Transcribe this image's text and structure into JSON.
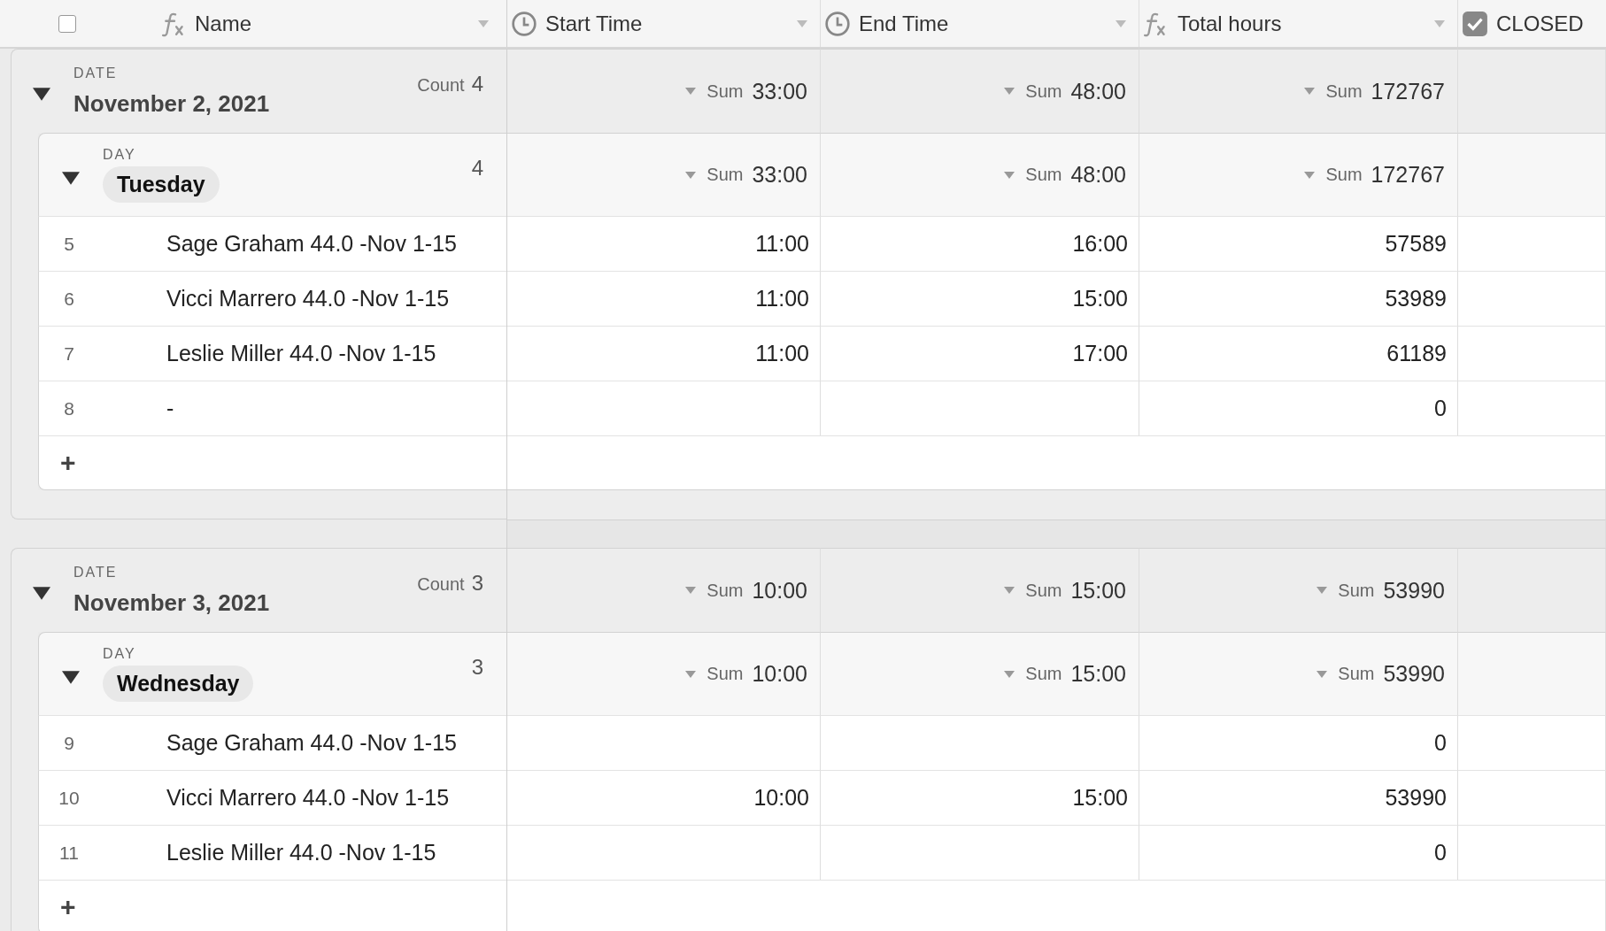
{
  "header": {
    "select_all": {
      "checked": false
    },
    "columns": [
      {
        "label": "Name"
      },
      {
        "label": "Start Time"
      },
      {
        "label": "End Time"
      },
      {
        "label": "Total hours"
      },
      {
        "label": "CLOSED"
      }
    ]
  },
  "groups": [
    {
      "field_label": "DATE",
      "title": "November 2, 2021",
      "count_label": "Count",
      "count": "4",
      "expanded": true,
      "sums": [
        {
          "label": "Sum",
          "value": "33:00"
        },
        {
          "label": "Sum",
          "value": "48:00"
        },
        {
          "label": "Sum",
          "value": "172767"
        }
      ],
      "subgroups": [
        {
          "field_label": "DAY",
          "title": "Tuesday",
          "count": "4",
          "expanded": true,
          "sums": [
            {
              "label": "Sum",
              "value": "33:00"
            },
            {
              "label": "Sum",
              "value": "48:00"
            },
            {
              "label": "Sum",
              "value": "172767"
            }
          ],
          "rows": [
            {
              "number": "5",
              "name": "Sage Graham 44.0 -Nov 1-15",
              "start_time": "11:00",
              "end_time": "16:00",
              "total_hours": "57589"
            },
            {
              "number": "6",
              "name": "Vicci Marrero 44.0 -Nov 1-15",
              "start_time": "11:00",
              "end_time": "15:00",
              "total_hours": "53989"
            },
            {
              "number": "7",
              "name": "Leslie Miller 44.0 -Nov 1-15",
              "start_time": "11:00",
              "end_time": "17:00",
              "total_hours": "61189"
            },
            {
              "number": "8",
              "name": "-",
              "start_time": "",
              "end_time": "",
              "total_hours": "0"
            }
          ],
          "add_button": "+"
        }
      ]
    },
    {
      "field_label": "DATE",
      "title": "November 3, 2021",
      "count_label": "Count",
      "count": "3",
      "expanded": true,
      "sums": [
        {
          "label": "Sum",
          "value": "10:00"
        },
        {
          "label": "Sum",
          "value": "15:00"
        },
        {
          "label": "Sum",
          "value": "53990"
        }
      ],
      "subgroups": [
        {
          "field_label": "DAY",
          "title": "Wednesday",
          "count": "3",
          "expanded": true,
          "sums": [
            {
              "label": "Sum",
              "value": "10:00"
            },
            {
              "label": "Sum",
              "value": "15:00"
            },
            {
              "label": "Sum",
              "value": "53990"
            }
          ],
          "rows": [
            {
              "number": "9",
              "name": "Sage Graham 44.0 -Nov 1-15",
              "start_time": "",
              "end_time": "",
              "total_hours": "0"
            },
            {
              "number": "10",
              "name": "Vicci Marrero 44.0 -Nov 1-15",
              "start_time": "10:00",
              "end_time": "15:00",
              "total_hours": "53990"
            },
            {
              "number": "11",
              "name": "Leslie Miller 44.0 -Nov 1-15",
              "start_time": "",
              "end_time": "",
              "total_hours": "0"
            }
          ],
          "add_button": "+"
        }
      ]
    }
  ]
}
